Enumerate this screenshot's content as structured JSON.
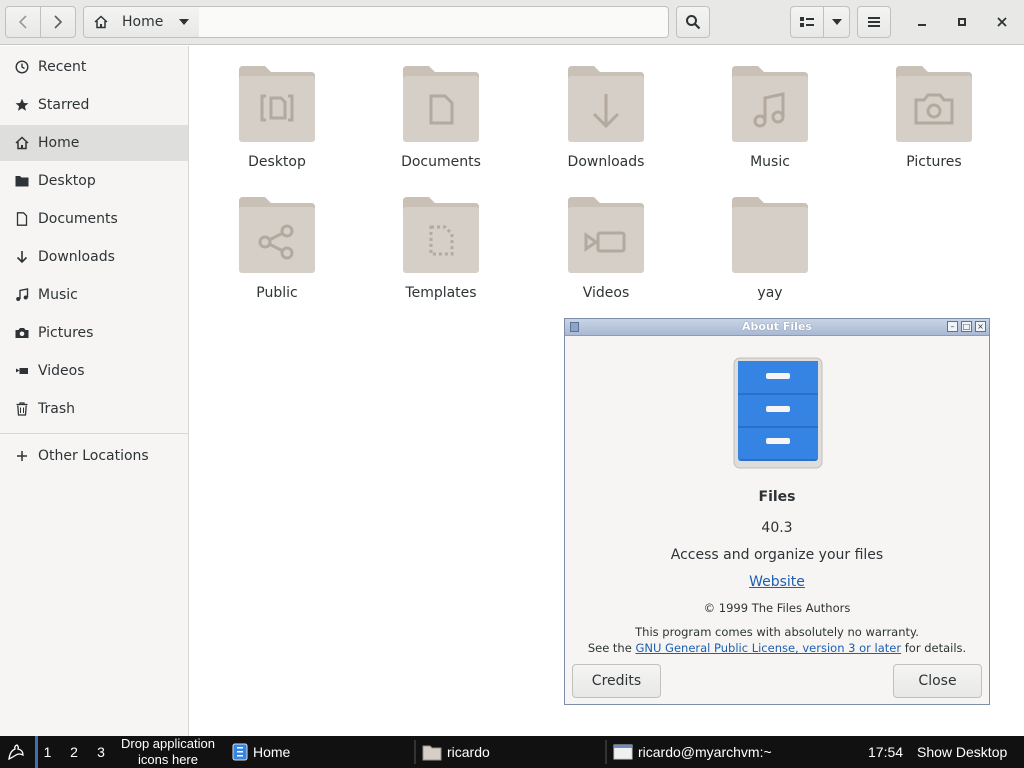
{
  "header": {
    "path_label": "Home",
    "path_value": ""
  },
  "sidebar": {
    "items": [
      {
        "label": "Recent",
        "icon": "clock-icon"
      },
      {
        "label": "Starred",
        "icon": "star-icon"
      },
      {
        "label": "Home",
        "icon": "home-icon"
      },
      {
        "label": "Desktop",
        "icon": "folder-icon"
      },
      {
        "label": "Documents",
        "icon": "document-icon"
      },
      {
        "label": "Downloads",
        "icon": "download-icon"
      },
      {
        "label": "Music",
        "icon": "music-icon"
      },
      {
        "label": "Pictures",
        "icon": "camera-icon"
      },
      {
        "label": "Videos",
        "icon": "video-icon"
      },
      {
        "label": "Trash",
        "icon": "trash-icon"
      }
    ],
    "other_locations": "Other Locations"
  },
  "files": [
    {
      "name": "Desktop",
      "emblem": "desktop"
    },
    {
      "name": "Documents",
      "emblem": "document"
    },
    {
      "name": "Downloads",
      "emblem": "download"
    },
    {
      "name": "Music",
      "emblem": "music"
    },
    {
      "name": "Pictures",
      "emblem": "camera"
    },
    {
      "name": "Public",
      "emblem": "share"
    },
    {
      "name": "Templates",
      "emblem": "template"
    },
    {
      "name": "Videos",
      "emblem": "video"
    },
    {
      "name": "yay",
      "emblem": "none"
    }
  ],
  "about": {
    "window_title": "About Files",
    "app_name": "Files",
    "version": "40.3",
    "description": "Access and organize your files",
    "website": "Website",
    "copyright": "© 1999 The Files Authors",
    "warranty_line1": "This program comes with absolutely no warranty.",
    "warranty_prefix": "See the",
    "license_link": "GNU General Public License, version 3 or later",
    "warranty_suffix": "for details.",
    "credits_button": "Credits",
    "close_button": "Close"
  },
  "taskbar": {
    "workspaces": [
      "1",
      "2",
      "3"
    ],
    "launcher_hint_line1": "Drop application",
    "launcher_hint_line2": "icons here",
    "tasks": [
      {
        "label": "Home",
        "icon": "file-cabinet-icon"
      },
      {
        "label": "ricardo",
        "icon": "folder-icon"
      },
      {
        "label": "ricardo@myarchvm:~",
        "icon": "terminal-icon"
      }
    ],
    "clock": "17:54",
    "show_desktop": "Show Desktop"
  },
  "colors": {
    "folder": "#d6cfc7",
    "folder_tab": "#c9c0b6",
    "accent_blue": "#3584e4",
    "link": "#1c5fb0"
  }
}
